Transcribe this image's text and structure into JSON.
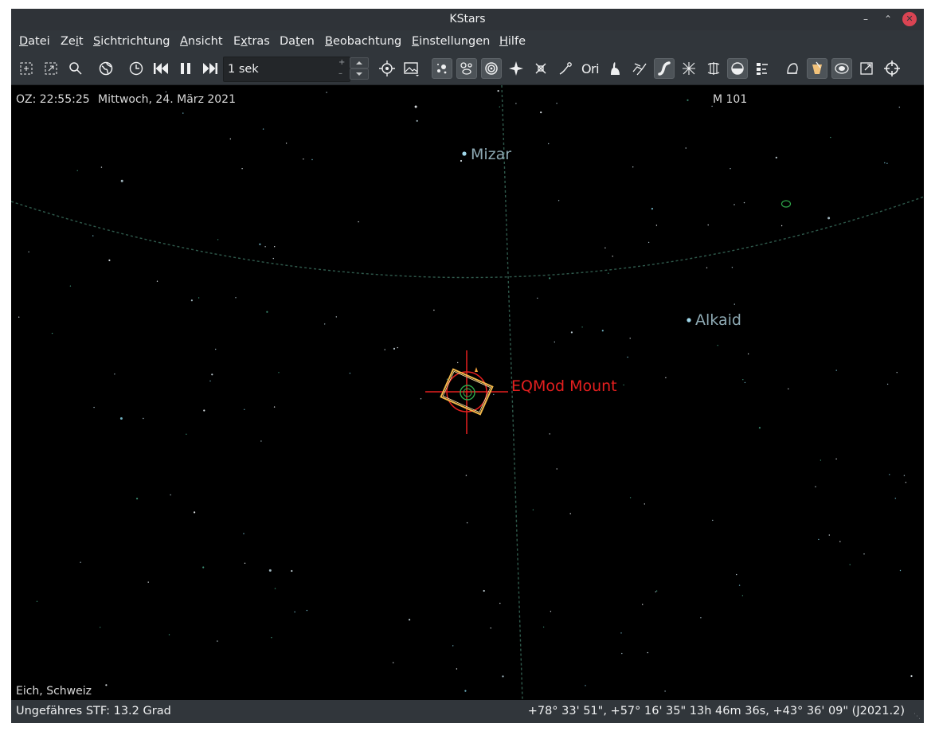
{
  "window": {
    "title": "KStars"
  },
  "menu": {
    "items": [
      {
        "acc": "D",
        "rest": "atei"
      },
      {
        "pre": "Ze",
        "acc": "i",
        "rest": "t"
      },
      {
        "acc": "S",
        "rest": "ichtrichtung"
      },
      {
        "acc": "A",
        "rest": "nsicht"
      },
      {
        "pre": "E",
        "acc": "x",
        "rest": "tras"
      },
      {
        "pre": "Da",
        "acc": "t",
        "rest": "en"
      },
      {
        "acc": "B",
        "rest": "eobachtung"
      },
      {
        "acc": "E",
        "rest": "instellungen"
      },
      {
        "acc": "H",
        "rest": "ilfe"
      }
    ]
  },
  "toolbar": {
    "time_step": "1 sek",
    "time_step_plus": "+",
    "time_step_minus": "–",
    "glyph_ori": "Ori"
  },
  "sky": {
    "time_info": "OZ: 22:55:25",
    "date_info": "Mittwoch, 24. März 2021",
    "focus_object": "M 101",
    "location": "Eich, Schweiz",
    "stars": [
      {
        "name": "Mizar",
        "color": "#9fd7ea"
      },
      {
        "name": "Alkaid",
        "color": "#9fd7ea"
      }
    ],
    "telescope_label": "EQMod Mount",
    "telescope_color": "#e51f1f",
    "fov_color": "#f2b84b"
  },
  "status": {
    "fov": "Ungefähres STF: 13.2 Grad",
    "coords": "+78° 33' 51\", +57° 16' 35\"  13h 46m 36s, +43° 36' 09\" (J2021.2)"
  }
}
